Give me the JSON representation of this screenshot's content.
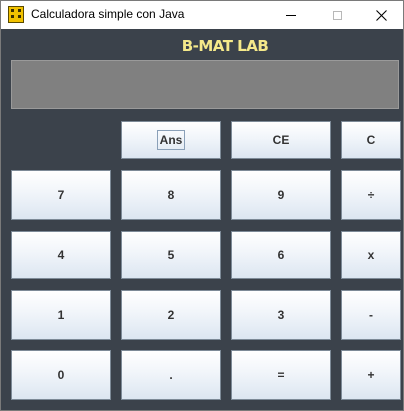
{
  "window": {
    "title": "Calculadora simple con Java",
    "icon": "calculator-icon",
    "controls": {
      "minimize": "minimize-icon",
      "maximize": "maximize-icon",
      "close": "close-icon"
    }
  },
  "header": {
    "brand": "B-MAT LAB"
  },
  "display": {
    "value": ""
  },
  "keys": {
    "ans": "Ans",
    "ce": "CE",
    "c": "C",
    "seven": "7",
    "eight": "8",
    "nine": "9",
    "divide": "÷",
    "four": "4",
    "five": "5",
    "six": "6",
    "multiply": "x",
    "one": "1",
    "two": "2",
    "three": "3",
    "subtract": "-",
    "zero": "0",
    "decimal": ".",
    "equals": "=",
    "add": "+"
  },
  "colors": {
    "background": "#3b424b",
    "brand": "#f5e98a",
    "display": "#808080"
  }
}
